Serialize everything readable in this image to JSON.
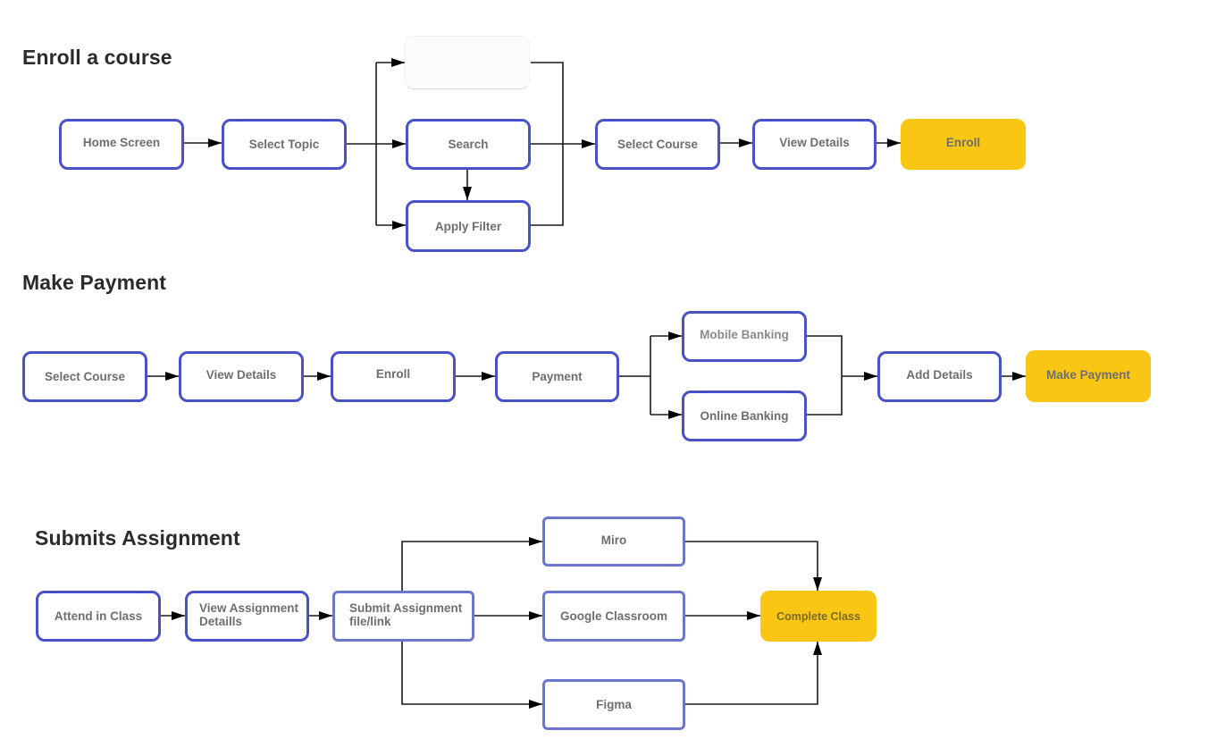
{
  "sections": [
    {
      "title": "Enroll a course",
      "nodes": [
        {
          "id": "home_screen",
          "label": "Home Screen"
        },
        {
          "id": "select_topic",
          "label": "Select Topic"
        },
        {
          "id": "blank",
          "label": ""
        },
        {
          "id": "search",
          "label": "Search"
        },
        {
          "id": "apply_filter",
          "label": "Apply Filter"
        },
        {
          "id": "select_course",
          "label": "Select Course"
        },
        {
          "id": "view_details",
          "label": "View Details"
        },
        {
          "id": "enroll",
          "label": "Enroll",
          "highlight": "#F9C613"
        }
      ]
    },
    {
      "title": "Make Payment",
      "nodes": [
        {
          "id": "select_course",
          "label": "Select Course"
        },
        {
          "id": "view_details",
          "label": "View Details"
        },
        {
          "id": "enroll",
          "label": "Enroll"
        },
        {
          "id": "payment",
          "label": "Payment"
        },
        {
          "id": "mobile_banking",
          "label": "Mobile Banking"
        },
        {
          "id": "online_banking",
          "label": "Online Banking"
        },
        {
          "id": "add_details",
          "label": "Add Details"
        },
        {
          "id": "make_payment",
          "label": "Make Payment",
          "highlight": "#F9C613"
        }
      ]
    },
    {
      "title": "Submits Assignment",
      "nodes": [
        {
          "id": "attend_class",
          "label": "Attend in Class"
        },
        {
          "id": "view_assignment",
          "label": "View Assignment\nDetaills"
        },
        {
          "id": "submit_assignment",
          "label": "Submit Assignment\nfile/link"
        },
        {
          "id": "miro",
          "label": "Miro"
        },
        {
          "id": "google_classroom",
          "label": "Google Classroom"
        },
        {
          "id": "figma",
          "label": "Figma"
        },
        {
          "id": "complete_class",
          "label": "Complete Class",
          "highlight": "#F9C613"
        }
      ]
    }
  ],
  "colors": {
    "node_border": "#4A50C6",
    "node_border_light": "#6E76CC",
    "goal_fill": "#F9C613",
    "edge": "#000000"
  }
}
